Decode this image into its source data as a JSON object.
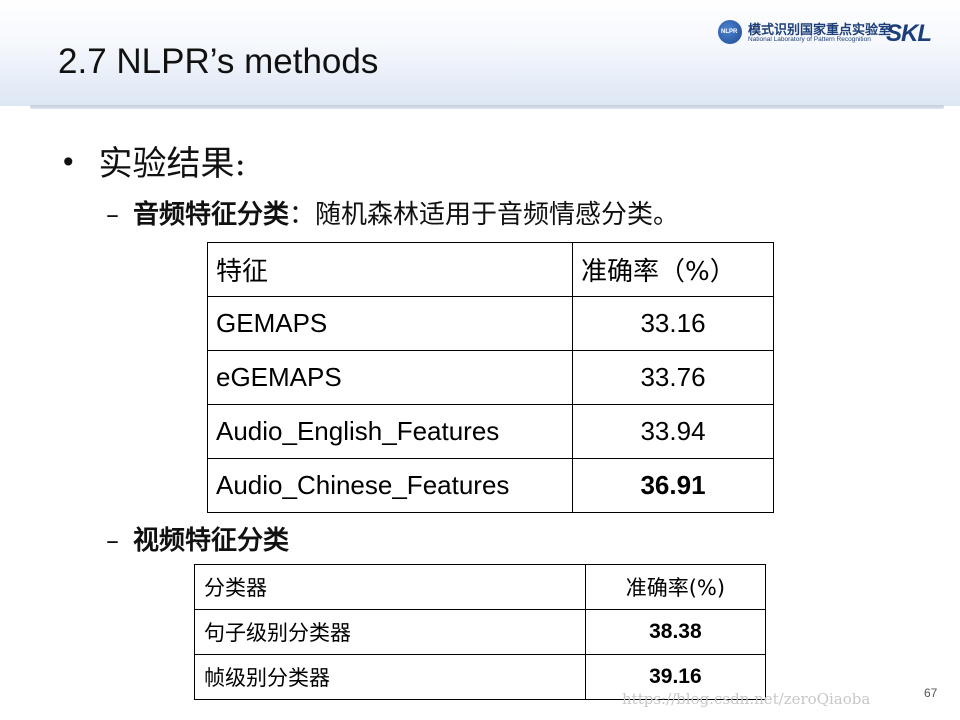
{
  "slide": {
    "title": "2.7 NLPR’s methods",
    "page_number": "67"
  },
  "logo": {
    "seal_text": "NLPR",
    "cn": "模式识别国家重点实验室",
    "en": "National Laboratory of Pattern Recognition",
    "skl": "SKL",
    "color": "#1d3f79"
  },
  "bullet": {
    "symbol": "•",
    "text": "实验结果:"
  },
  "audio_section": {
    "dash": "–",
    "bold_text": "音频特征分类",
    "rest_text": "：随机森林适用于音频情感分类。"
  },
  "audio_table": {
    "headers": [
      "特征",
      "准确率（%）"
    ],
    "rows": [
      [
        "GEMAPS",
        "33.16"
      ],
      [
        "eGEMAPS",
        "33.76"
      ],
      [
        "Audio_English_Features",
        "33.94"
      ],
      [
        "Audio_Chinese_Features",
        "36.91"
      ]
    ]
  },
  "video_section": {
    "dash": "–",
    "bold_text": "视频特征分类"
  },
  "video_table": {
    "headers": [
      "分类器",
      "准确率(%)"
    ],
    "rows": [
      [
        "句子级别分类器",
        "38.38"
      ],
      [
        "帧级别分类器",
        "39.16"
      ]
    ]
  },
  "watermark": "https://blog.csdn.net/zeroQiaoba"
}
